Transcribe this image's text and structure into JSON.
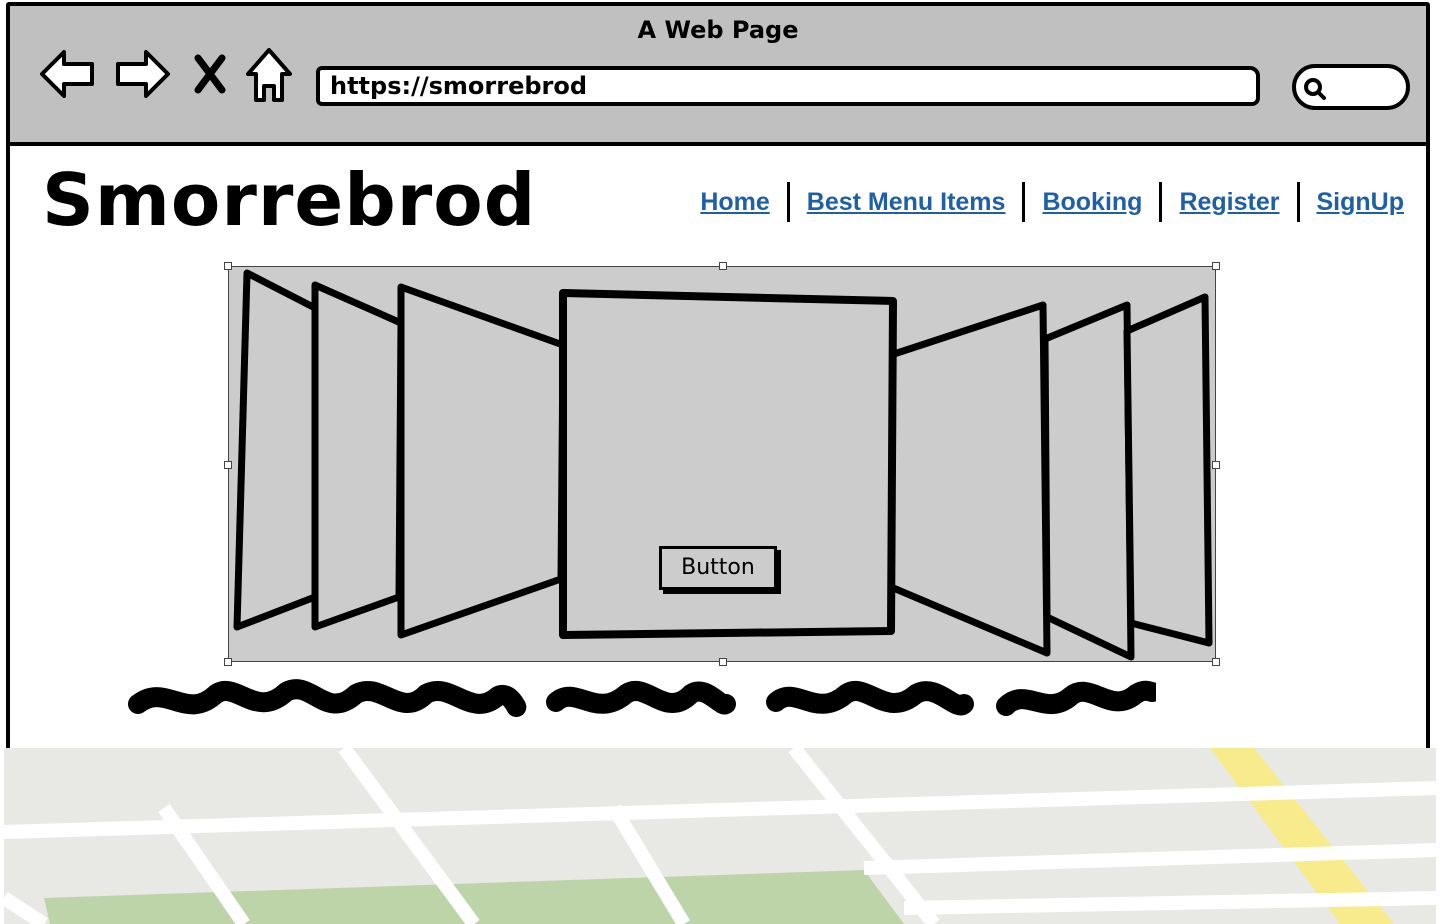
{
  "window": {
    "title": "A Web Page"
  },
  "toolbar": {
    "url": "https://smorrebrod",
    "icons": [
      "back-arrow-icon",
      "forward-arrow-icon",
      "close-x-icon",
      "home-icon",
      "search-icon"
    ]
  },
  "site": {
    "logo": "Smorrebrod",
    "nav": [
      {
        "label": "Home"
      },
      {
        "label": "Best Menu Items"
      },
      {
        "label": "Booking"
      },
      {
        "label": "Register"
      },
      {
        "label": "SignUp"
      }
    ]
  },
  "carousel": {
    "button_label": "Button"
  },
  "colors": {
    "chrome": "#c0c0c0",
    "panel": "#cccccc",
    "link": "#1f5fa8",
    "map_base": "#e8e8e4",
    "map_park": "#bdd4a8",
    "map_highway": "#f7eb8c"
  }
}
